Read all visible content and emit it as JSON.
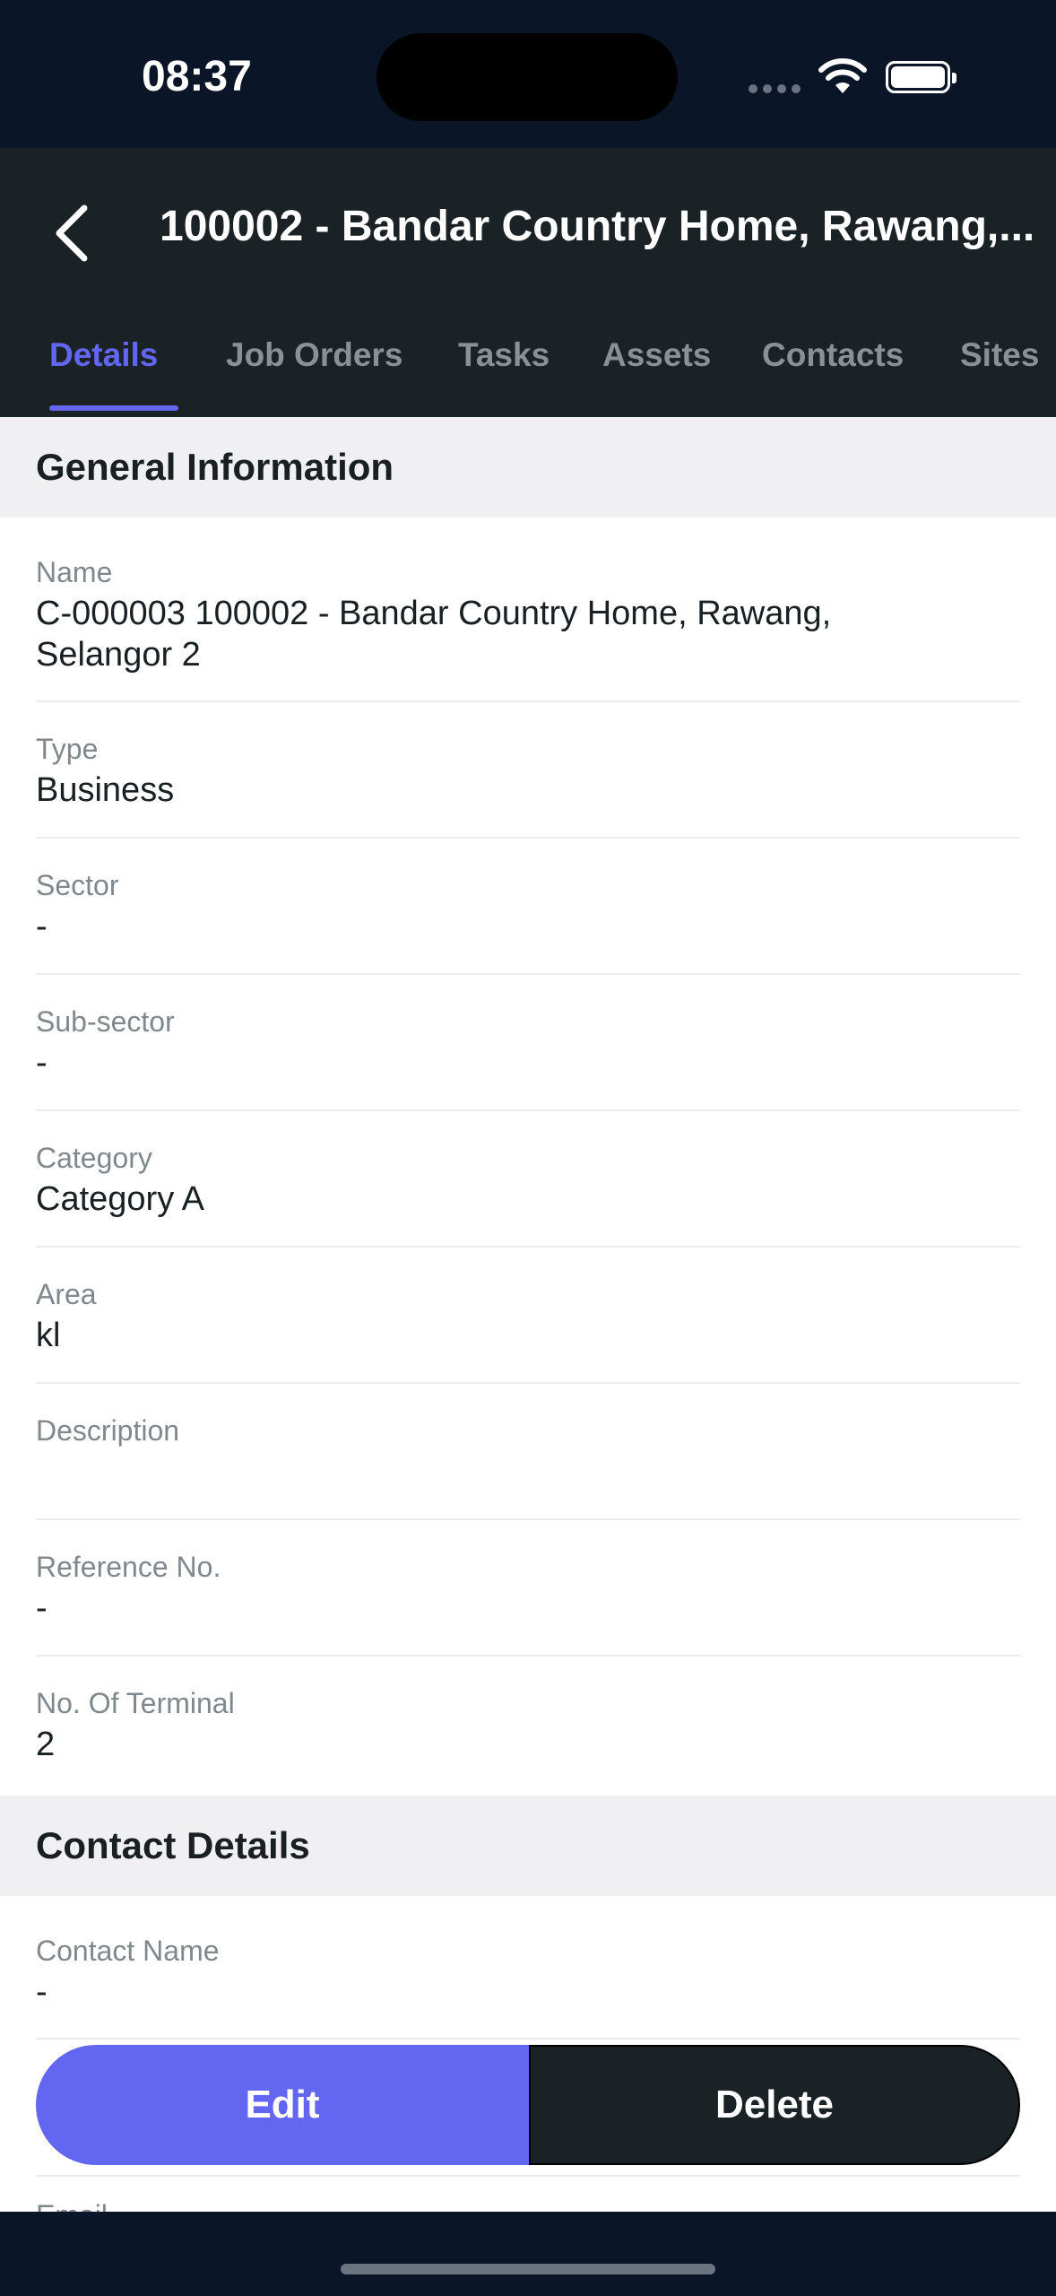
{
  "status_bar": {
    "time": "08:37"
  },
  "header": {
    "title": "100002 - Bandar Country Home, Rawang,..."
  },
  "tabs": [
    {
      "label": "Details",
      "active": true
    },
    {
      "label": "Job Orders",
      "active": false
    },
    {
      "label": "Tasks",
      "active": false
    },
    {
      "label": "Assets",
      "active": false
    },
    {
      "label": "Contacts",
      "active": false
    },
    {
      "label": "Sites",
      "active": false
    }
  ],
  "general": {
    "title": "General Information",
    "fields": [
      {
        "label": "Name",
        "value": "C-000003 100002 - Bandar Country Home, Rawang, Selangor 2"
      },
      {
        "label": "Type",
        "value": "Business"
      },
      {
        "label": "Sector",
        "value": "-"
      },
      {
        "label": "Sub-sector",
        "value": "-"
      },
      {
        "label": "Category",
        "value": "Category A"
      },
      {
        "label": "Area",
        "value": "kl"
      },
      {
        "label": "Description",
        "value": ""
      },
      {
        "label": "Reference No.",
        "value": "-"
      },
      {
        "label": "No. Of Terminal",
        "value": "2"
      }
    ]
  },
  "contact": {
    "title": "Contact Details",
    "fields": [
      {
        "label": "Contact Name",
        "value": "-"
      },
      {
        "label": "Email",
        "value": ""
      }
    ]
  },
  "actions": {
    "edit_label": "Edit",
    "delete_label": "Delete"
  },
  "colors": {
    "accent": "#6366f1",
    "header_bg": "#1b2226",
    "status_bg": "#0a1628"
  }
}
